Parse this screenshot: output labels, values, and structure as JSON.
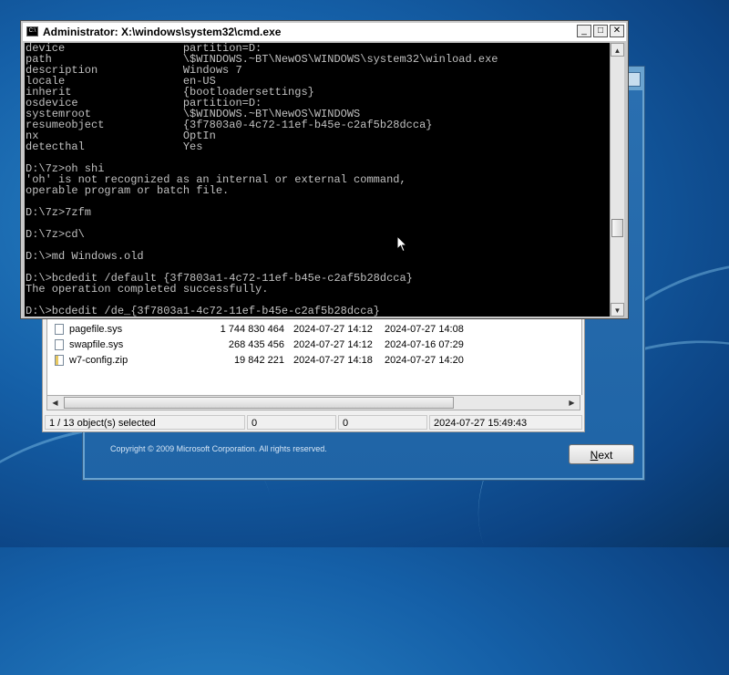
{
  "cmd": {
    "title": "Administrator: X:\\windows\\system32\\cmd.exe",
    "icon_text": "C:\\",
    "minimize_glyph": "_",
    "restore_glyph": "□",
    "close_glyph": "✕",
    "console_lines": [
      "device                  partition=D:",
      "path                    \\$WINDOWS.~BT\\NewOS\\WINDOWS\\system32\\winload.exe",
      "description             Windows 7",
      "locale                  en-US",
      "inherit                 {bootloadersettings}",
      "osdevice                partition=D:",
      "systemroot              \\$WINDOWS.~BT\\NewOS\\WINDOWS",
      "resumeobject            {3f7803a0-4c72-11ef-b45e-c2af5b28dcca}",
      "nx                      OptIn",
      "detecthal               Yes",
      "",
      "D:\\7z>oh shi",
      "'oh' is not recognized as an internal or external command,",
      "operable program or batch file.",
      "",
      "D:\\7z>7zfm",
      "",
      "D:\\7z>cd\\",
      "",
      "D:\\>md Windows.old",
      "",
      "D:\\>bcdedit /default {3f7803a1-4c72-11ef-b45e-c2af5b28dcca}",
      "The operation completed successfully.",
      "",
      "D:\\>bcdedit /de_{3f7803a1-4c72-11ef-b45e-c2af5b28dcca}"
    ]
  },
  "explorer": {
    "files": [
      {
        "name": "pagefile.sys",
        "size": "1 744 830 464",
        "modified": "2024-07-27 14:12",
        "created": "2024-07-27 14:08",
        "icon": "file-icon"
      },
      {
        "name": "swapfile.sys",
        "size": "268 435 456",
        "modified": "2024-07-27 14:12",
        "created": "2024-07-16 07:29",
        "icon": "file-icon"
      },
      {
        "name": "w7-config.zip",
        "size": "19 842 221",
        "modified": "2024-07-27 14:18",
        "created": "2024-07-27 14:20",
        "icon": "zip-icon"
      }
    ],
    "status": {
      "selected": "1 / 13 object(s) selected",
      "size": "0",
      "packed": "0",
      "time": "2024-07-27 15:49:43"
    }
  },
  "setup": {
    "copyright": "Copyright © 2009 Microsoft Corporation. All rights reserved.",
    "next_accel": "N",
    "next_rest": "ext"
  }
}
